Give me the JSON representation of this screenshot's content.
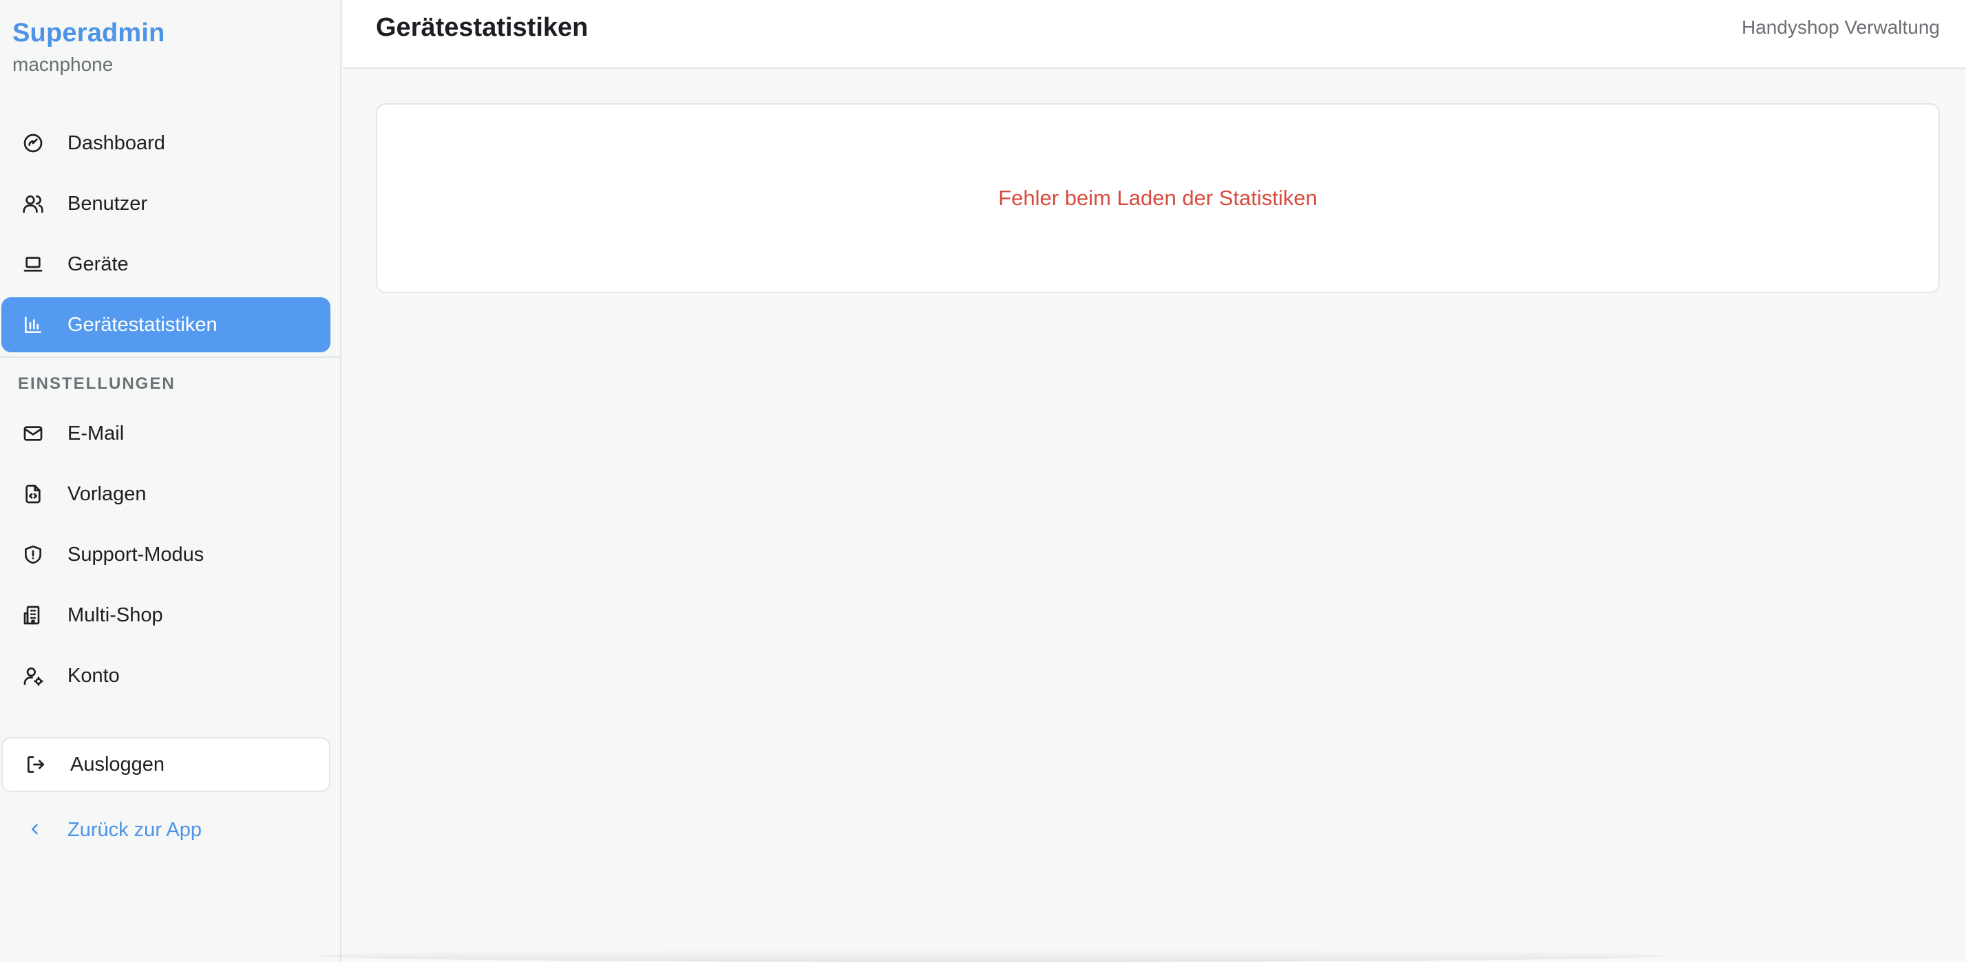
{
  "brand": {
    "title": "Superadmin",
    "subtitle": "macnphone"
  },
  "sidebar": {
    "items": [
      {
        "label": "Dashboard",
        "icon": "gauge-icon"
      },
      {
        "label": "Benutzer",
        "icon": "users-icon"
      },
      {
        "label": "Geräte",
        "icon": "laptop-icon"
      },
      {
        "label": "Gerätestatistiken",
        "icon": "bar-chart-icon",
        "active": true
      }
    ],
    "section_label": "EINSTELLUNGEN",
    "settings_items": [
      {
        "label": "E-Mail",
        "icon": "mail-icon"
      },
      {
        "label": "Vorlagen",
        "icon": "file-code-icon"
      },
      {
        "label": "Support-Modus",
        "icon": "shield-icon"
      },
      {
        "label": "Multi-Shop",
        "icon": "building-icon"
      },
      {
        "label": "Konto",
        "icon": "user-cog-icon"
      }
    ],
    "logout_label": "Ausloggen",
    "back_label": "Zurück zur App"
  },
  "header": {
    "title": "Gerätestatistiken",
    "right_text": "Handyshop Verwaltung"
  },
  "main": {
    "error_message": "Fehler beim Laden der Statistiken"
  },
  "colors": {
    "accent": "#539af0",
    "brand": "#4d94e6",
    "error": "#d64c3e"
  }
}
